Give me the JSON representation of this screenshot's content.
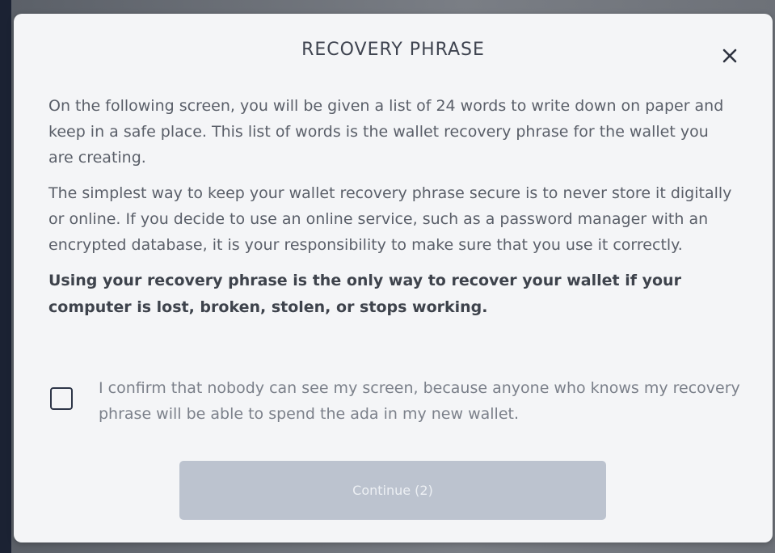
{
  "dialog": {
    "title": "RECOVERY PHRASE",
    "close_icon": "close-icon",
    "paragraphs": [
      "On the following screen, you will be given a list of 24 words to write down on paper and keep in a safe place. This list of words is the wallet recovery phrase for the wallet you are creating.",
      "The simplest way to keep your wallet recovery phrase secure is to never store it digitally or online. If you decide to use an online service, such as a password manager with an encrypted database, it is your responsibility to make sure that you use it correctly.",
      "Using your recovery phrase is the only way to recover your wallet if your computer is lost, broken, stolen, or stops working."
    ],
    "confirm": {
      "checked": false,
      "label": "I confirm that nobody can see my screen, because anyone who knows my recovery phrase will be able to spend the ada in my new wallet."
    },
    "continue_button": {
      "label": "Continue (2)",
      "disabled": true
    }
  },
  "colors": {
    "dialog_background": "#f4f5f7",
    "title_text": "#3f4450",
    "body_text": "#5a5f69",
    "checkbox_border": "#2e3648",
    "button_disabled_bg": "#bcc3cf",
    "button_disabled_text": "#edf0f4"
  }
}
